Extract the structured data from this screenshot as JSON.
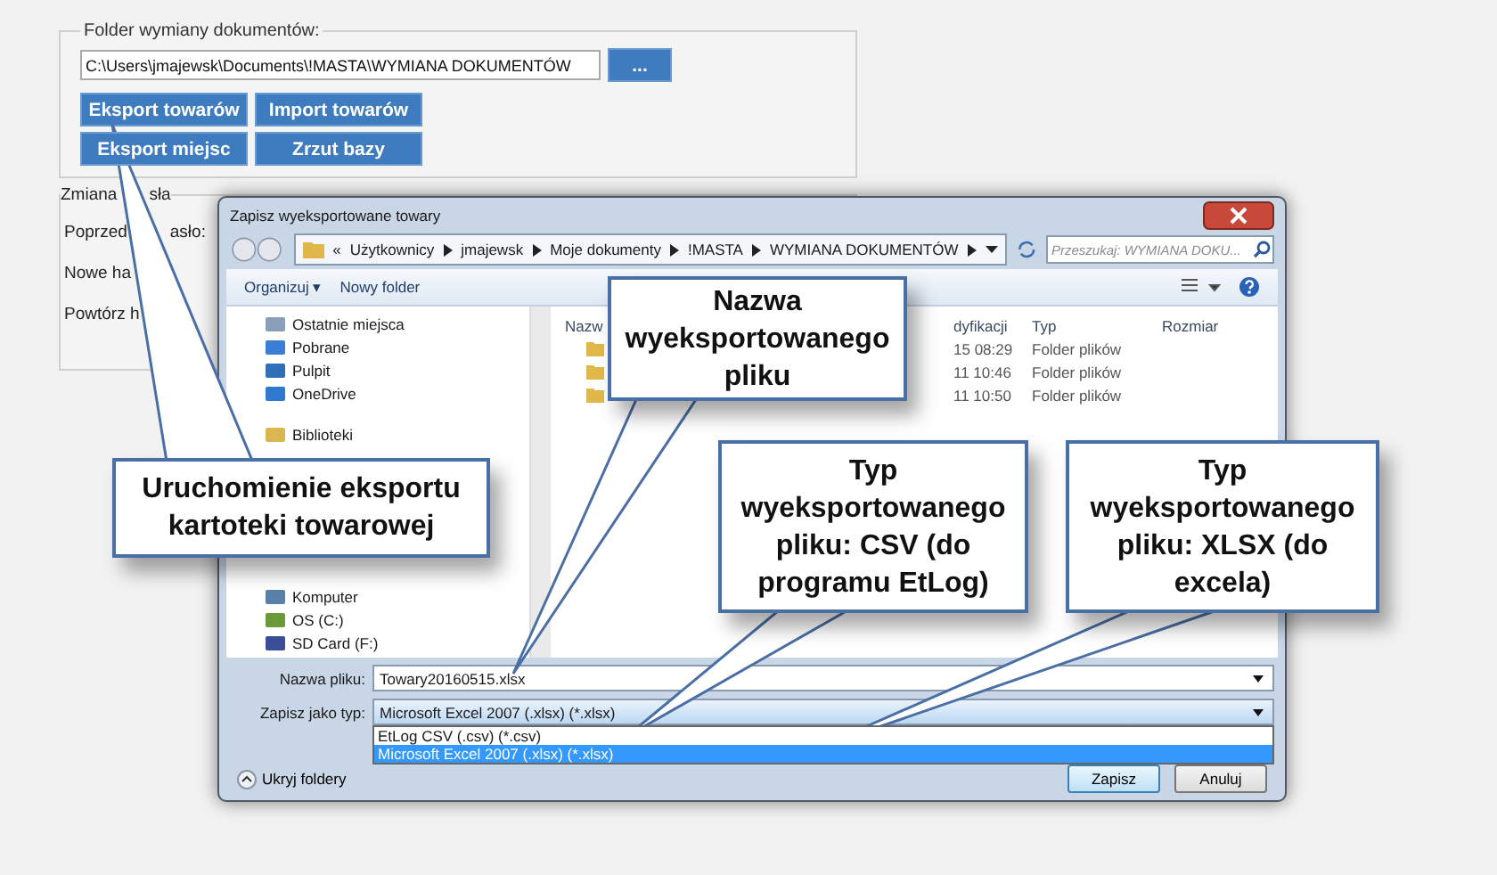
{
  "folder_group": {
    "title": "Folder wymiany dokumentów:",
    "path": "C:\\Users\\jmajewsk\\Documents\\!MASTA\\WYMIANA DOKUMENTÓW",
    "browse_button": "...",
    "buttons": [
      "Eksport towarów",
      "Import towarów",
      "Eksport miejsc",
      "Zrzut bazy"
    ]
  },
  "password_group": {
    "title": [
      "Zmiana",
      "sła"
    ],
    "labels": [
      [
        "Poprzed",
        "asło:"
      ],
      [
        "Nowe ha"
      ],
      [
        "Powtórz h"
      ]
    ]
  },
  "dialog": {
    "title": "Zapisz wyeksportowane towary",
    "breadcrumb": [
      "«",
      "Użytkownicy",
      "jmajewsk",
      "Moje dokumenty",
      "!MASTA",
      "WYMIANA DOKUMENTÓW"
    ],
    "search": {
      "placeholder": "Przeszukaj: WYMIANA DOKU..."
    },
    "toolbar": [
      "Organizuj ▾",
      "Nowy folder"
    ],
    "nav_groups": [
      {
        "items": [
          {
            "kind": "recent",
            "label": "Ostatnie miejsca"
          },
          {
            "kind": "download",
            "label": "Pobrane"
          },
          {
            "kind": "desktop",
            "label": "Pulpit"
          },
          {
            "kind": "cloud",
            "label": "OneDrive"
          }
        ]
      },
      {
        "items": [
          {
            "kind": "library",
            "label": "Biblioteki"
          }
        ]
      },
      {
        "items": [
          {
            "kind": "computer",
            "label": "Komputer"
          },
          {
            "kind": "drive",
            "label": "OS (C:)"
          },
          {
            "kind": "sdcard",
            "label": "SD Card (F:)"
          }
        ]
      }
    ],
    "columns": [
      "Nazw",
      "dyfikacji",
      "Typ",
      "Rozmiar"
    ],
    "rows": [
      {
        "date": "15 08:29",
        "type": "Folder plików"
      },
      {
        "date": "11 10:46",
        "type": "Folder plików"
      },
      {
        "date": "11 10:50",
        "type": "Folder plików"
      }
    ],
    "filename_label": "Nazwa pliku:",
    "filename": "Towary20160515.xlsx",
    "type_label": "Zapisz jako typ:",
    "type_value": "Microsoft Excel 2007 (.xlsx) (*.xlsx)",
    "type_options": [
      {
        "label": "EtLog CSV (.csv) (*.csv)",
        "selected": false
      },
      {
        "label": "Microsoft Excel 2007 (.xlsx) (*.xlsx)",
        "selected": true
      }
    ],
    "hide_folders": "Ukryj foldery",
    "buttons": [
      "Zapisz",
      "Anuluj"
    ]
  },
  "callouts": [
    {
      "text": "Uruchomienie eksportu kartoteki towarowej"
    },
    {
      "text": "Nazwa wyeksportowanego pliku"
    },
    {
      "text": "Typ wyeksportowanego pliku: CSV (do programu EtLog)"
    },
    {
      "text": "Typ wyeksportowanego pliku: XLSX (do excela)"
    }
  ]
}
